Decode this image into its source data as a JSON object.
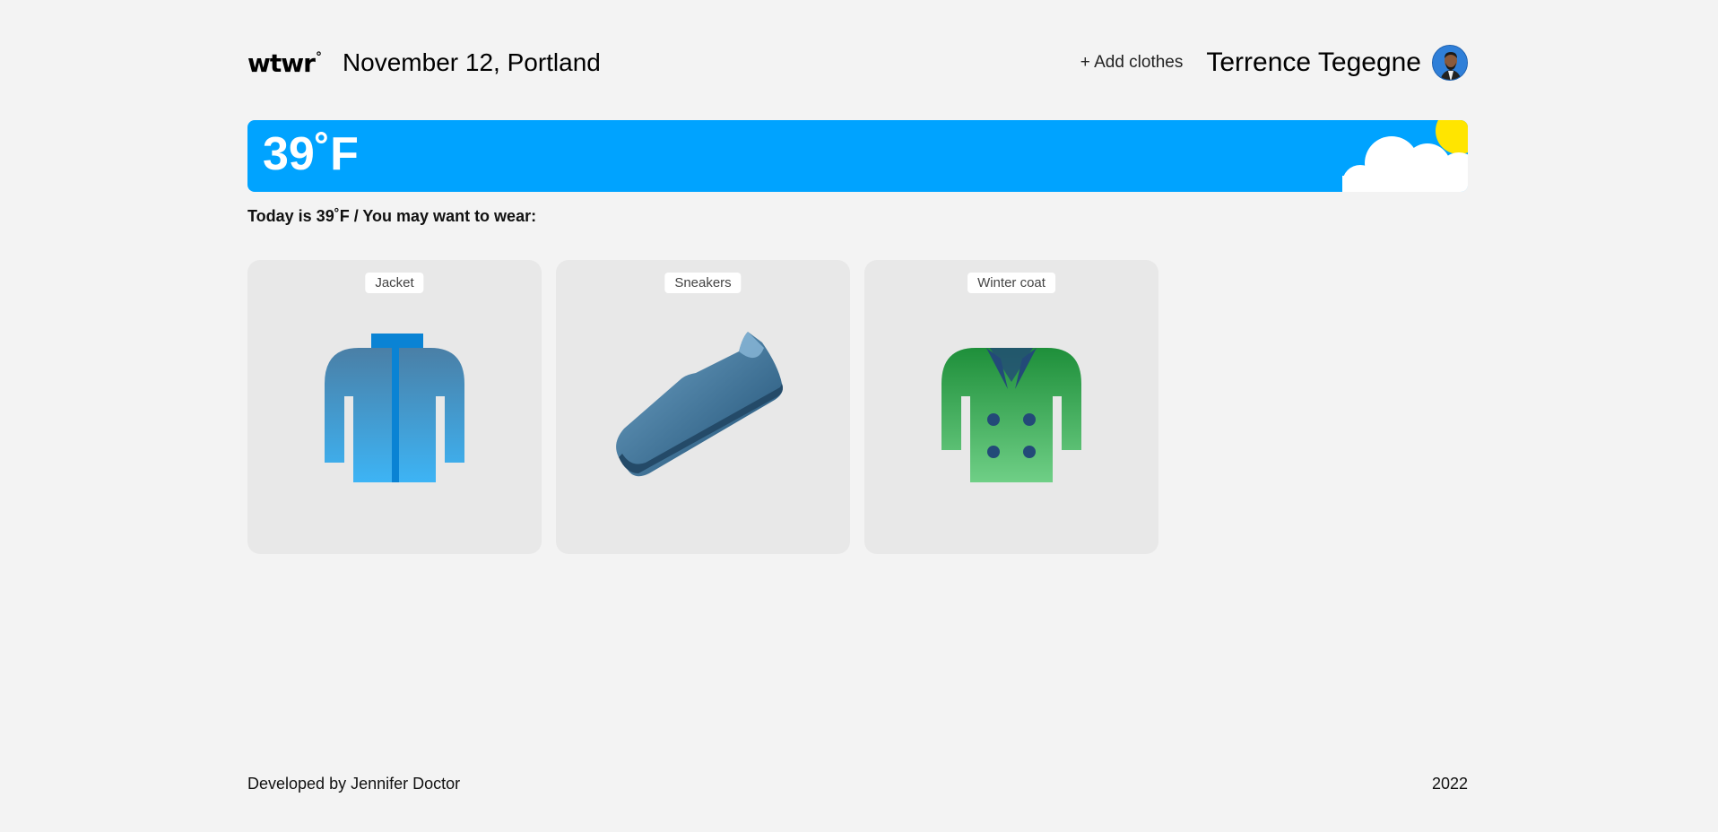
{
  "header": {
    "logo": "wtwr",
    "logo_degree": "°",
    "date_location": "November 12, Portland",
    "add_clothes_label": "+ Add clothes",
    "user_name": "Terrence Tegegne"
  },
  "weather": {
    "temperature": "39˚F",
    "condition_icons": [
      "cloud-icon",
      "sun-icon"
    ]
  },
  "caption": "Today is 39˚F / You may want to wear:",
  "items": [
    {
      "label": "Jacket",
      "icon": "jacket-icon"
    },
    {
      "label": "Sneakers",
      "icon": "sneaker-icon"
    },
    {
      "label": "Winter coat",
      "icon": "winter-coat-icon"
    }
  ],
  "footer": {
    "credit": "Developed by Jennifer Doctor",
    "year": "2022"
  },
  "colors": {
    "banner": "#00a3ff",
    "background": "#f3f3f3",
    "card": "#e8e8e8",
    "sun": "#ffe500"
  }
}
